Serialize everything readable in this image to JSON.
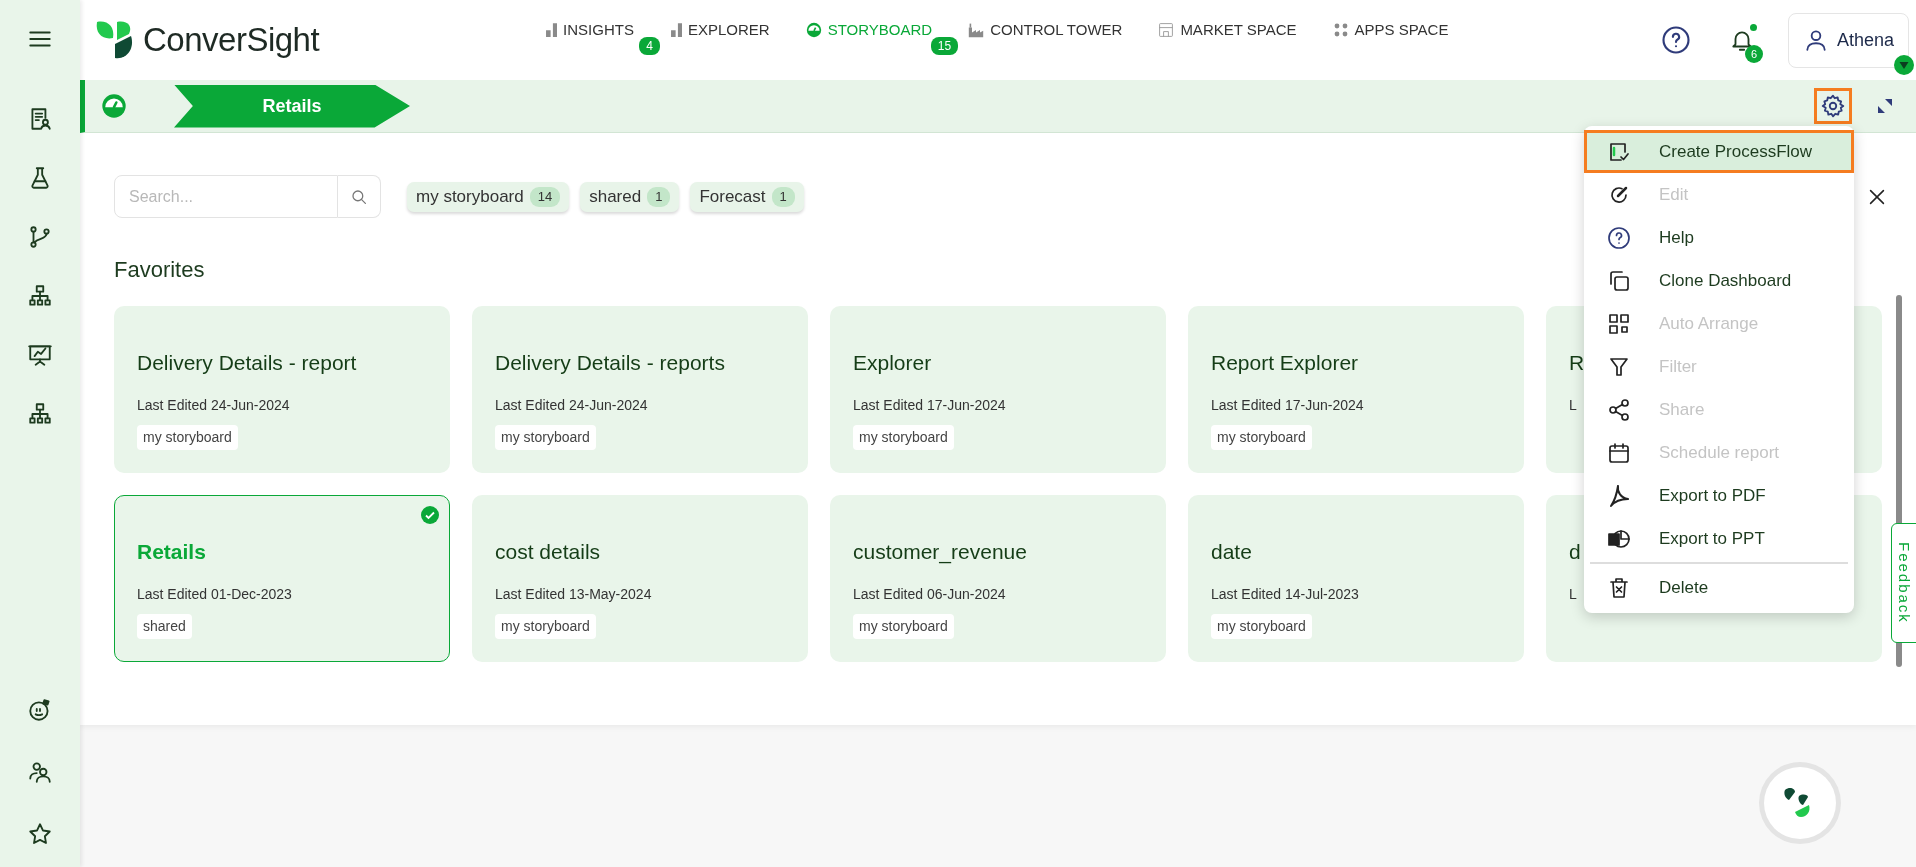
{
  "header": {
    "logo_text": "ConverSight",
    "nav": [
      {
        "label": "INSIGHTS",
        "badge": "4",
        "selected": false
      },
      {
        "label": "EXPLORER",
        "selected": false
      },
      {
        "label": "STORYBOARD",
        "badge": "15",
        "selected": true
      },
      {
        "label": "CONTROL TOWER",
        "selected": false
      },
      {
        "label": "MARKET SPACE",
        "selected": false
      },
      {
        "label": "APPS SPACE",
        "selected": false
      }
    ],
    "notifications_badge": "6",
    "user": "Athena"
  },
  "breadcrumb": {
    "title": "Retails"
  },
  "filters": {
    "search_placeholder": "Search...",
    "chips": [
      {
        "label": "my storyboard",
        "count": "14"
      },
      {
        "label": "shared",
        "count": "1"
      },
      {
        "label": "Forecast",
        "count": "1"
      }
    ]
  },
  "section_title": "Favorites",
  "cards": [
    {
      "title": "Delivery Details - report",
      "edited": "Last Edited 24-Jun-2024",
      "tag": "my storyboard",
      "selected": false
    },
    {
      "title": "Delivery Details - reports",
      "edited": "Last Edited 24-Jun-2024",
      "tag": "my storyboard",
      "selected": false
    },
    {
      "title": "Explorer",
      "edited": "Last Edited 17-Jun-2024",
      "tag": "my storyboard",
      "selected": false
    },
    {
      "title": "Report Explorer",
      "edited": "Last Edited 17-Jun-2024",
      "tag": "my storyboard",
      "selected": false
    },
    {
      "title": "R",
      "edited": "L",
      "selected": false
    },
    {
      "title": "Retails",
      "edited": "Last Edited 01-Dec-2023",
      "tag": "shared",
      "selected": true
    },
    {
      "title": "cost details",
      "edited": "Last Edited 13-May-2024",
      "tag": "my storyboard",
      "selected": false
    },
    {
      "title": "customer_revenue",
      "edited": "Last Edited 06-Jun-2024",
      "tag": "my storyboard",
      "selected": false
    },
    {
      "title": "date",
      "edited": "Last Edited 14-Jul-2023",
      "tag": "my storyboard",
      "selected": false
    },
    {
      "title": "d",
      "edited": "L",
      "selected": false
    }
  ],
  "menu": {
    "items": [
      {
        "label": "Create ProcessFlow",
        "disabled": false,
        "selected": true
      },
      {
        "label": "Edit",
        "disabled": true,
        "selected": false
      },
      {
        "label": "Help",
        "disabled": false,
        "selected": false
      },
      {
        "label": "Clone Dashboard",
        "disabled": false,
        "selected": false
      },
      {
        "label": "Auto Arrange",
        "disabled": true,
        "selected": false
      },
      {
        "label": "Filter",
        "disabled": true,
        "selected": false
      },
      {
        "label": "Share",
        "disabled": true,
        "selected": false
      },
      {
        "label": "Schedule report",
        "disabled": true,
        "selected": false
      },
      {
        "label": "Export to PDF",
        "disabled": false,
        "selected": false
      },
      {
        "label": "Export to PPT",
        "disabled": false,
        "selected": false
      },
      {
        "label": "Delete",
        "disabled": false,
        "selected": false,
        "separator_before": true
      }
    ]
  },
  "feedback_tab": "Feedback"
}
